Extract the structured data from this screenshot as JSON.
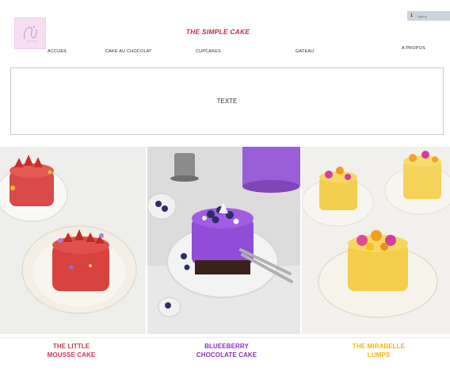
{
  "header": {
    "title": "THE SIMPLE CAKE",
    "cart": {
      "count": "1",
      "label": "signup"
    }
  },
  "nav": {
    "items": [
      {
        "label": "ACCUEIL"
      },
      {
        "label": "CAKE AU CHOCOLAT"
      },
      {
        "label": "CUPCAKES"
      },
      {
        "label": "GATEAU"
      },
      {
        "label": "A PROPOS"
      }
    ]
  },
  "main": {
    "text_box": "TEXTE"
  },
  "gallery": [
    {
      "line1": "THE LITTLE",
      "line2": "MOUSSE CAKE",
      "color": "#d0364f"
    },
    {
      "line1": "BLUEEBERRY",
      "line2": "CHOCOLATE CAKE",
      "color": "#8a2fc6"
    },
    {
      "line1": "THE MIRABELLE",
      "line2": "LUMPS",
      "color": "#f0b41c"
    }
  ],
  "colors": {
    "title": "#c5283d",
    "cart_bg": "#cdd3dc",
    "logo_bg": "#f6dff3"
  }
}
